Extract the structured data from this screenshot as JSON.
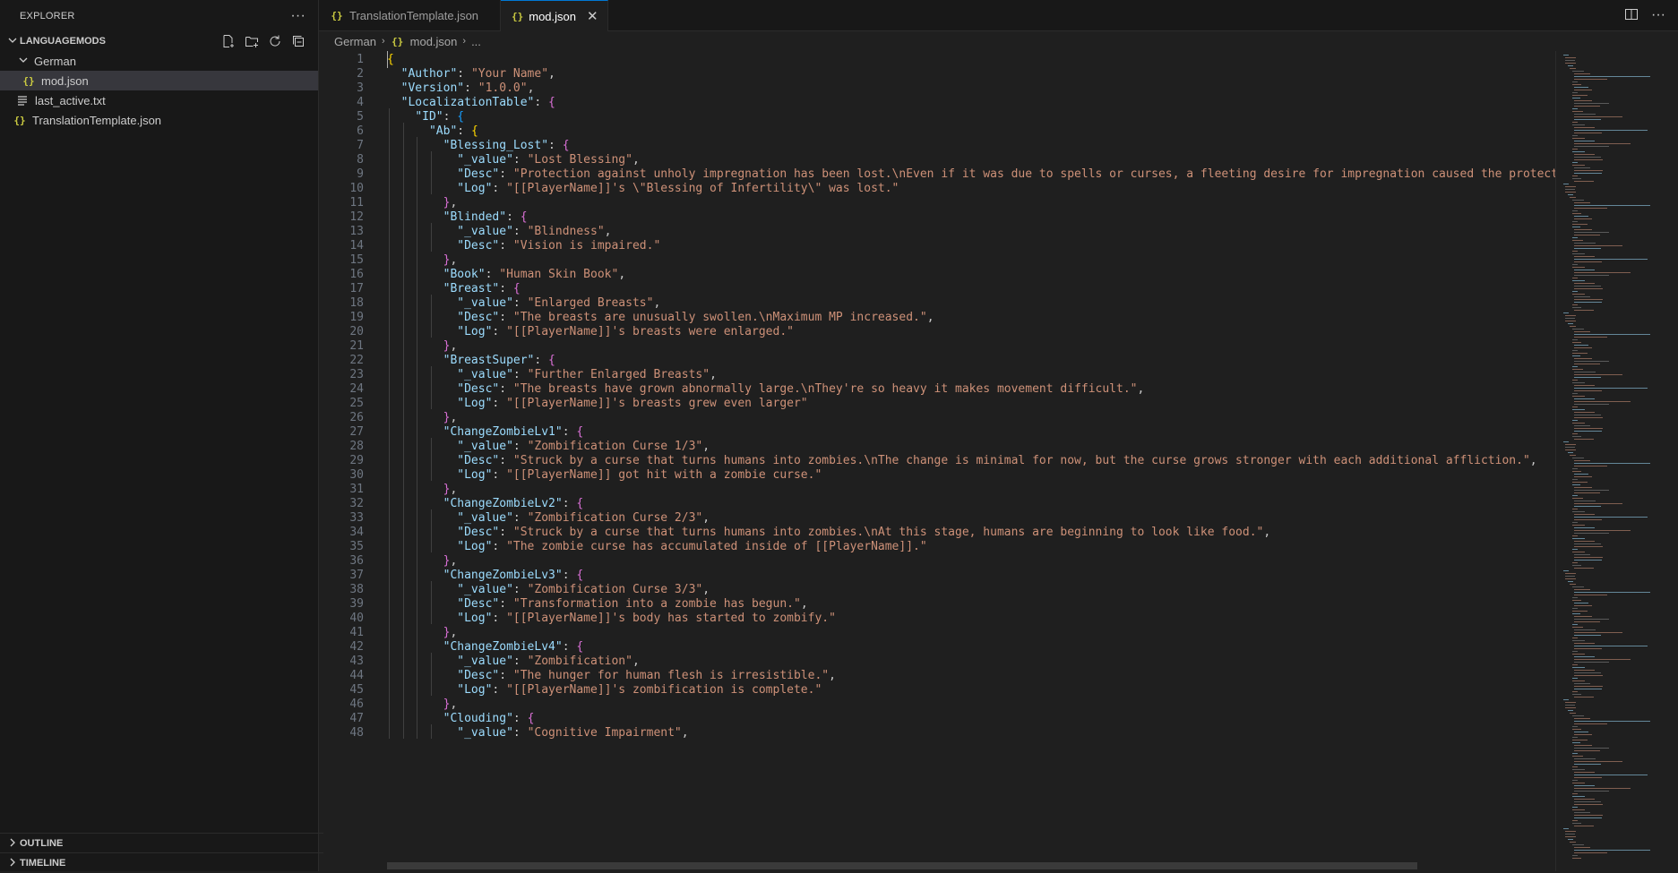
{
  "sidebar": {
    "title": "EXPLORER",
    "more_icon": "ellipsis-icon",
    "workspace": "LANGUAGEMODS",
    "folders": [
      {
        "name": "German",
        "files": [
          {
            "name": "mod.json",
            "selected": true
          }
        ]
      }
    ],
    "root_files": [
      {
        "name": "last_active.txt"
      },
      {
        "name": "TranslationTemplate.json"
      }
    ],
    "outline_label": "OUTLINE",
    "timeline_label": "TIMELINE"
  },
  "tabs": [
    {
      "label": "TranslationTemplate.json",
      "active": false
    },
    {
      "label": "mod.json",
      "active": true
    }
  ],
  "breadcrumb": {
    "folder": "German",
    "file": "mod.json",
    "more": "..."
  },
  "editor": {
    "lines": [
      [
        [
          "b1",
          "{"
        ]
      ],
      [
        [
          "i",
          "  "
        ],
        [
          "k",
          "\"Author\""
        ],
        [
          "p",
          ": "
        ],
        [
          "s",
          "\"Your Name\""
        ],
        [
          "p",
          ","
        ]
      ],
      [
        [
          "i",
          "  "
        ],
        [
          "k",
          "\"Version\""
        ],
        [
          "p",
          ": "
        ],
        [
          "s",
          "\"1.0.0\""
        ],
        [
          "p",
          ","
        ]
      ],
      [
        [
          "i",
          "  "
        ],
        [
          "k",
          "\"LocalizationTable\""
        ],
        [
          "p",
          ": "
        ],
        [
          "b2",
          "{"
        ]
      ],
      [
        [
          "i",
          "    "
        ],
        [
          "k",
          "\"ID\""
        ],
        [
          "p",
          ": "
        ],
        [
          "b3",
          "{"
        ]
      ],
      [
        [
          "i",
          "      "
        ],
        [
          "k",
          "\"Ab\""
        ],
        [
          "p",
          ": "
        ],
        [
          "b1",
          "{"
        ]
      ],
      [
        [
          "i",
          "        "
        ],
        [
          "k",
          "\"Blessing_Lost\""
        ],
        [
          "p",
          ": "
        ],
        [
          "b2",
          "{"
        ]
      ],
      [
        [
          "i",
          "          "
        ],
        [
          "k",
          "\"_value\""
        ],
        [
          "p",
          ": "
        ],
        [
          "s",
          "\"Lost Blessing\""
        ],
        [
          "p",
          ","
        ]
      ],
      [
        [
          "i",
          "          "
        ],
        [
          "k",
          "\"Desc\""
        ],
        [
          "p",
          ": "
        ],
        [
          "s",
          "\"Protection against unholy impregnation has been lost.\\nEven if it was due to spells or curses, a fleeting desire for impregnation caused the protective"
        ]
      ],
      [
        [
          "i",
          "          "
        ],
        [
          "k",
          "\"Log\""
        ],
        [
          "p",
          ": "
        ],
        [
          "s",
          "\"[[PlayerName]]'s \\\"Blessing of Infertility\\\" was lost.\""
        ]
      ],
      [
        [
          "i",
          "        "
        ],
        [
          "b2",
          "}"
        ],
        [
          "p",
          ","
        ]
      ],
      [
        [
          "i",
          "        "
        ],
        [
          "k",
          "\"Blinded\""
        ],
        [
          "p",
          ": "
        ],
        [
          "b2",
          "{"
        ]
      ],
      [
        [
          "i",
          "          "
        ],
        [
          "k",
          "\"_value\""
        ],
        [
          "p",
          ": "
        ],
        [
          "s",
          "\"Blindness\""
        ],
        [
          "p",
          ","
        ]
      ],
      [
        [
          "i",
          "          "
        ],
        [
          "k",
          "\"Desc\""
        ],
        [
          "p",
          ": "
        ],
        [
          "s",
          "\"Vision is impaired.\""
        ]
      ],
      [
        [
          "i",
          "        "
        ],
        [
          "b2",
          "}"
        ],
        [
          "p",
          ","
        ]
      ],
      [
        [
          "i",
          "        "
        ],
        [
          "k",
          "\"Book\""
        ],
        [
          "p",
          ": "
        ],
        [
          "s",
          "\"Human Skin Book\""
        ],
        [
          "p",
          ","
        ]
      ],
      [
        [
          "i",
          "        "
        ],
        [
          "k",
          "\"Breast\""
        ],
        [
          "p",
          ": "
        ],
        [
          "b2",
          "{"
        ]
      ],
      [
        [
          "i",
          "          "
        ],
        [
          "k",
          "\"_value\""
        ],
        [
          "p",
          ": "
        ],
        [
          "s",
          "\"Enlarged Breasts\""
        ],
        [
          "p",
          ","
        ]
      ],
      [
        [
          "i",
          "          "
        ],
        [
          "k",
          "\"Desc\""
        ],
        [
          "p",
          ": "
        ],
        [
          "s",
          "\"The breasts are unusually swollen.\\nMaximum MP increased.\""
        ],
        [
          "p",
          ","
        ]
      ],
      [
        [
          "i",
          "          "
        ],
        [
          "k",
          "\"Log\""
        ],
        [
          "p",
          ": "
        ],
        [
          "s",
          "\"[[PlayerName]]'s breasts were enlarged.\""
        ]
      ],
      [
        [
          "i",
          "        "
        ],
        [
          "b2",
          "}"
        ],
        [
          "p",
          ","
        ]
      ],
      [
        [
          "i",
          "        "
        ],
        [
          "k",
          "\"BreastSuper\""
        ],
        [
          "p",
          ": "
        ],
        [
          "b2",
          "{"
        ]
      ],
      [
        [
          "i",
          "          "
        ],
        [
          "k",
          "\"_value\""
        ],
        [
          "p",
          ": "
        ],
        [
          "s",
          "\"Further Enlarged Breasts\""
        ],
        [
          "p",
          ","
        ]
      ],
      [
        [
          "i",
          "          "
        ],
        [
          "k",
          "\"Desc\""
        ],
        [
          "p",
          ": "
        ],
        [
          "s",
          "\"The breasts have grown abnormally large.\\nThey're so heavy it makes movement difficult.\""
        ],
        [
          "p",
          ","
        ]
      ],
      [
        [
          "i",
          "          "
        ],
        [
          "k",
          "\"Log\""
        ],
        [
          "p",
          ": "
        ],
        [
          "s",
          "\"[[PlayerName]]'s breasts grew even larger\""
        ]
      ],
      [
        [
          "i",
          "        "
        ],
        [
          "b2",
          "}"
        ],
        [
          "p",
          ","
        ]
      ],
      [
        [
          "i",
          "        "
        ],
        [
          "k",
          "\"ChangeZombieLv1\""
        ],
        [
          "p",
          ": "
        ],
        [
          "b2",
          "{"
        ]
      ],
      [
        [
          "i",
          "          "
        ],
        [
          "k",
          "\"_value\""
        ],
        [
          "p",
          ": "
        ],
        [
          "s",
          "\"Zombification Curse 1/3\""
        ],
        [
          "p",
          ","
        ]
      ],
      [
        [
          "i",
          "          "
        ],
        [
          "k",
          "\"Desc\""
        ],
        [
          "p",
          ": "
        ],
        [
          "s",
          "\"Struck by a curse that turns humans into zombies.\\nThe change is minimal for now, but the curse grows stronger with each additional affliction.\""
        ],
        [
          "p",
          ","
        ]
      ],
      [
        [
          "i",
          "          "
        ],
        [
          "k",
          "\"Log\""
        ],
        [
          "p",
          ": "
        ],
        [
          "s",
          "\"[[PlayerName]] got hit with a zombie curse.\""
        ]
      ],
      [
        [
          "i",
          "        "
        ],
        [
          "b2",
          "}"
        ],
        [
          "p",
          ","
        ]
      ],
      [
        [
          "i",
          "        "
        ],
        [
          "k",
          "\"ChangeZombieLv2\""
        ],
        [
          "p",
          ": "
        ],
        [
          "b2",
          "{"
        ]
      ],
      [
        [
          "i",
          "          "
        ],
        [
          "k",
          "\"_value\""
        ],
        [
          "p",
          ": "
        ],
        [
          "s",
          "\"Zombification Curse 2/3\""
        ],
        [
          "p",
          ","
        ]
      ],
      [
        [
          "i",
          "          "
        ],
        [
          "k",
          "\"Desc\""
        ],
        [
          "p",
          ": "
        ],
        [
          "s",
          "\"Struck by a curse that turns humans into zombies.\\nAt this stage, humans are beginning to look like food.\""
        ],
        [
          "p",
          ","
        ]
      ],
      [
        [
          "i",
          "          "
        ],
        [
          "k",
          "\"Log\""
        ],
        [
          "p",
          ": "
        ],
        [
          "s",
          "\"The zombie curse has accumulated inside of [[PlayerName]].\""
        ]
      ],
      [
        [
          "i",
          "        "
        ],
        [
          "b2",
          "}"
        ],
        [
          "p",
          ","
        ]
      ],
      [
        [
          "i",
          "        "
        ],
        [
          "k",
          "\"ChangeZombieLv3\""
        ],
        [
          "p",
          ": "
        ],
        [
          "b2",
          "{"
        ]
      ],
      [
        [
          "i",
          "          "
        ],
        [
          "k",
          "\"_value\""
        ],
        [
          "p",
          ": "
        ],
        [
          "s",
          "\"Zombification Curse 3/3\""
        ],
        [
          "p",
          ","
        ]
      ],
      [
        [
          "i",
          "          "
        ],
        [
          "k",
          "\"Desc\""
        ],
        [
          "p",
          ": "
        ],
        [
          "s",
          "\"Transformation into a zombie has begun.\""
        ],
        [
          "p",
          ","
        ]
      ],
      [
        [
          "i",
          "          "
        ],
        [
          "k",
          "\"Log\""
        ],
        [
          "p",
          ": "
        ],
        [
          "s",
          "\"[[PlayerName]]'s body has started to zombify.\""
        ]
      ],
      [
        [
          "i",
          "        "
        ],
        [
          "b2",
          "}"
        ],
        [
          "p",
          ","
        ]
      ],
      [
        [
          "i",
          "        "
        ],
        [
          "k",
          "\"ChangeZombieLv4\""
        ],
        [
          "p",
          ": "
        ],
        [
          "b2",
          "{"
        ]
      ],
      [
        [
          "i",
          "          "
        ],
        [
          "k",
          "\"_value\""
        ],
        [
          "p",
          ": "
        ],
        [
          "s",
          "\"Zombification\""
        ],
        [
          "p",
          ","
        ]
      ],
      [
        [
          "i",
          "          "
        ],
        [
          "k",
          "\"Desc\""
        ],
        [
          "p",
          ": "
        ],
        [
          "s",
          "\"The hunger for human flesh is irresistible.\""
        ],
        [
          "p",
          ","
        ]
      ],
      [
        [
          "i",
          "          "
        ],
        [
          "k",
          "\"Log\""
        ],
        [
          "p",
          ": "
        ],
        [
          "s",
          "\"[[PlayerName]]'s zombification is complete.\""
        ]
      ],
      [
        [
          "i",
          "        "
        ],
        [
          "b2",
          "}"
        ],
        [
          "p",
          ","
        ]
      ],
      [
        [
          "i",
          "        "
        ],
        [
          "k",
          "\"Clouding\""
        ],
        [
          "p",
          ": "
        ],
        [
          "b2",
          "{"
        ]
      ],
      [
        [
          "i",
          "          "
        ],
        [
          "k",
          "\"_value\""
        ],
        [
          "p",
          ": "
        ],
        [
          "s",
          "\"Cognitive Impairment\""
        ],
        [
          "p",
          ","
        ]
      ]
    ]
  },
  "colors": {
    "key": "#9cdcfe",
    "string": "#ce9178",
    "bracket1": "#ffd700",
    "bracket2": "#da70d6",
    "bracket3": "#179fff",
    "json_icon": "#cbcb41",
    "active_tab_border": "#0078d4"
  }
}
